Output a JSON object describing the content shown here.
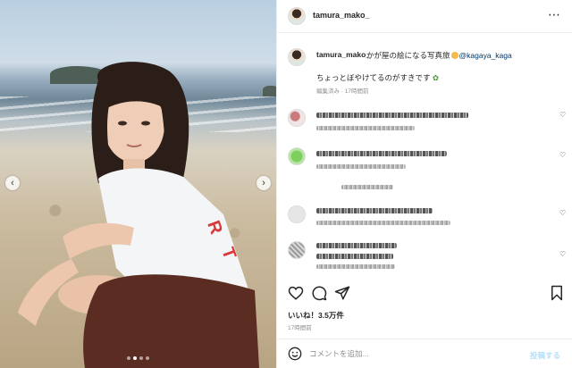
{
  "post": {
    "username": "tamura_mako_",
    "more_icon": "ellipsis-icon",
    "photo_alt": "beach photo",
    "carousel": {
      "prev_icon": "chevron-left-icon",
      "next_icon": "chevron-right-icon",
      "dots": 4,
      "active_dot": 2
    }
  },
  "caption": {
    "username": "tamura_mako_",
    "text_before": "かが屋の絵になる写真旅",
    "mention": "@kagaya_kaga",
    "line2": "ちょっとぼやけてるのがすきです",
    "meta": "編集済み · 17時間前"
  },
  "comments": [
    {
      "avatar_color": "#c97a7a",
      "blurred": true
    },
    {
      "avatar_color": "#7fcf5f",
      "blurred": true
    },
    {
      "avatar_color": "#cfcfcf",
      "blurred": true
    },
    {
      "avatar_color": "#d9d9d9",
      "blurred": true
    },
    {
      "avatar_color": "#9a9a9a",
      "blurred": true
    }
  ],
  "actions": {
    "like_icon": "heart-icon",
    "comment_icon": "comment-icon",
    "share_icon": "paper-plane-icon",
    "save_icon": "bookmark-icon"
  },
  "likes_text": "いいね！3.5万件",
  "time_text": "17時間前",
  "comment_box": {
    "emoji_icon": "smiley-icon",
    "placeholder": "コメントを追加...",
    "post_label": "投稿する"
  }
}
